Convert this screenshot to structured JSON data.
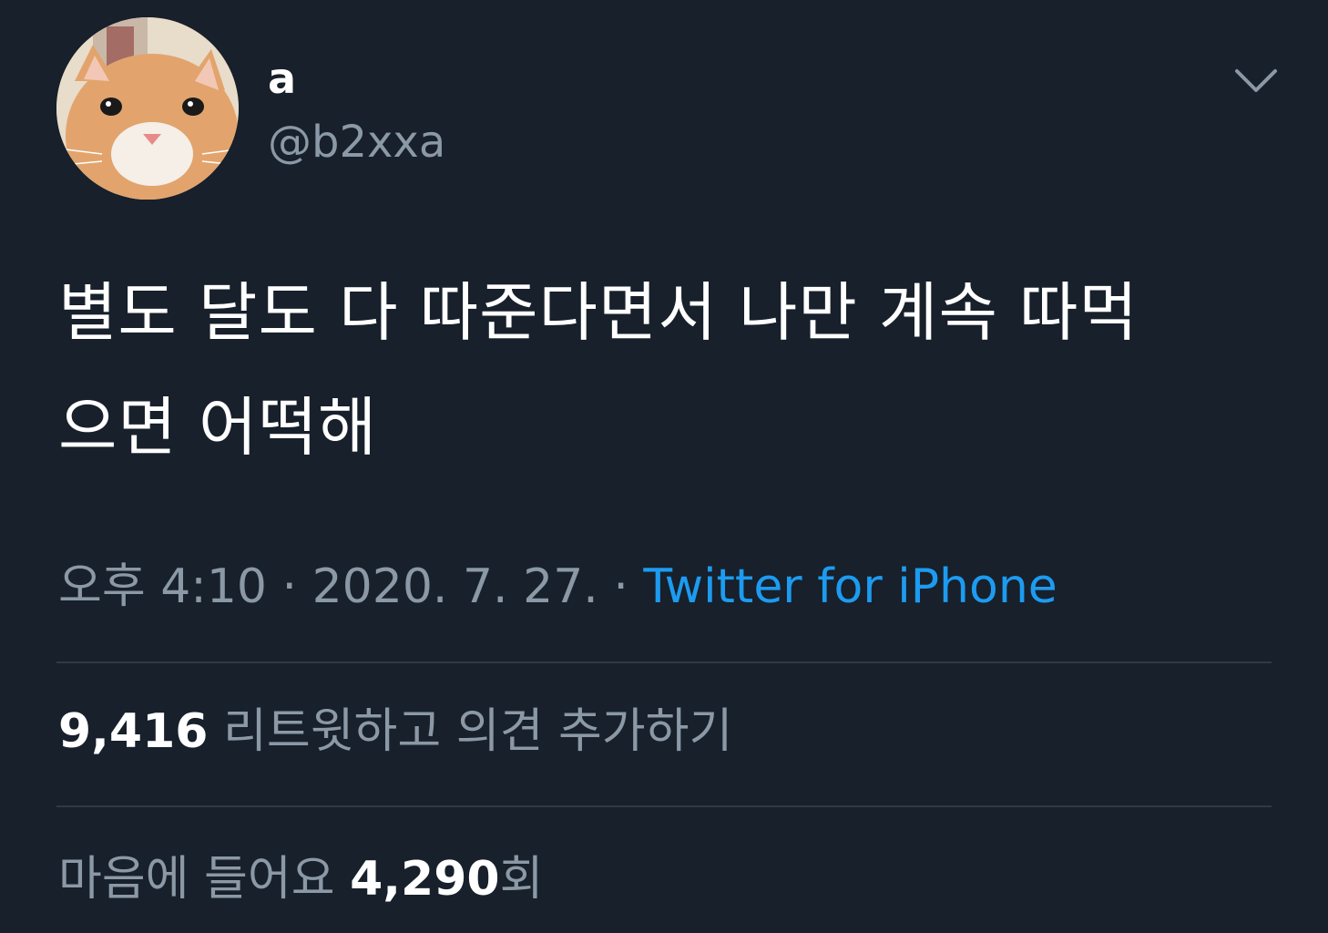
{
  "tweet": {
    "display_name": "a",
    "handle": "@b2xxa",
    "text_line1": "별도 달도 다 따준다면서 나만 계속 따먹",
    "text_line2": "으면 어떡해",
    "time": "오후 4:10",
    "separator": "·",
    "date": "2020. 7. 27.",
    "source": "Twitter for iPhone"
  },
  "stats": {
    "retweets_count": "9,416",
    "retweets_label": "리트윗하고 의견 추가하기",
    "likes_label": "마음에 들어요",
    "likes_count": "4,290",
    "likes_suffix": "회"
  },
  "icons": {
    "avatar": "cat-avatar",
    "menu": "chevron-down-icon"
  },
  "colors": {
    "background": "#17202b",
    "primary_text": "#ffffff",
    "secondary_text": "#8b98a5",
    "link": "#1d9bf0",
    "divider": "#2f3a46"
  }
}
